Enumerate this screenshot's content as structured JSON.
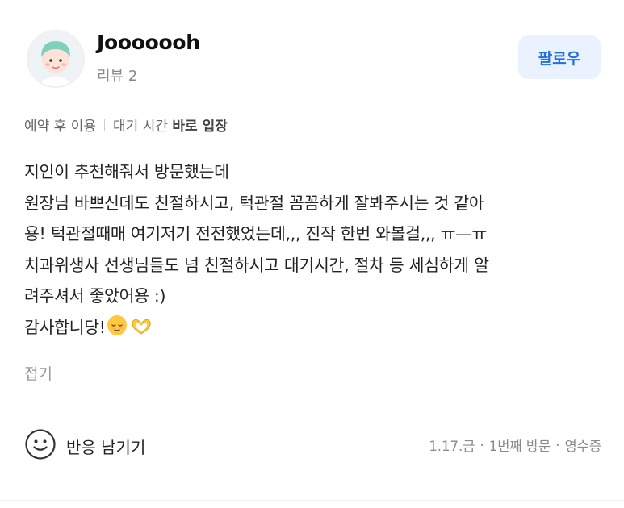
{
  "profile": {
    "username": "Jooooooh",
    "review_count": "리뷰 2",
    "follow_label": "팔로우",
    "avatar_icon": "avatar-icon"
  },
  "tags": {
    "reservation": "예약 후 이용",
    "wait_prefix": "대기 시간",
    "wait_value": "바로 입장"
  },
  "review": {
    "lines": [
      "지인이 추천해줘서 방문했는데",
      "원장님 바쁘신데도 친절하시고, 턱관절 꼼꼼하게 잘봐주시는 것 같아",
      "용! 턱관절때매 여기저기 전전했었는데,,, 진작 한번 와볼걸,,, ㅠ—ㅠ",
      "치과위생사 선생님들도 넘 친절하시고 대기시간, 절차 등 세심하게 알",
      "려주셔서 좋았어용 :)",
      "감사합니당!"
    ],
    "emojis": [
      "relieved-face-emoji",
      "heart-hands-emoji"
    ],
    "collapse_label": "접기"
  },
  "footer": {
    "react_label": "반응 남기기",
    "react_icon": "smiley-icon",
    "date": "1.17.금",
    "visit": "1번째 방문",
    "receipt": "영수증"
  },
  "colors": {
    "accent": "#1f6fe5",
    "follow_bg": "#eaf2ff",
    "muted": "#888888"
  }
}
